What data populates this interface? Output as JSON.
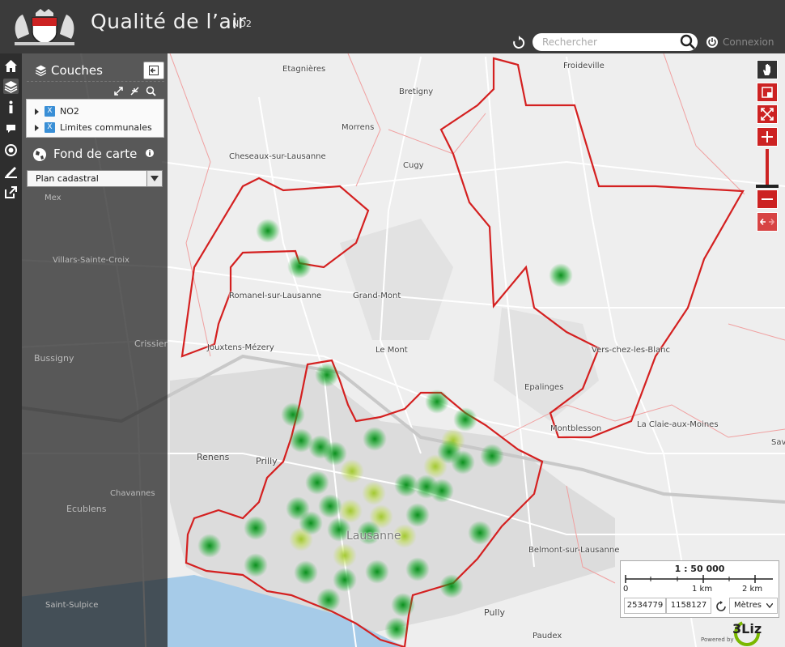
{
  "header": {
    "title": "Qualité de l’air",
    "subtitle": "NO2",
    "search_placeholder": "Rechercher",
    "login_label": "Connexion"
  },
  "panel": {
    "layers_title": "Couches",
    "layers": [
      {
        "name": "NO2",
        "checked": true
      },
      {
        "name": "Limites communales",
        "checked": true
      }
    ],
    "basemap_title": "Fond de carte",
    "basemap_selected": "Plan cadastral"
  },
  "menu_icons": [
    "home-icon",
    "layers-icon",
    "info-icon",
    "comment-icon",
    "locate-icon",
    "measure-icon",
    "share-icon"
  ],
  "nav_icons": [
    "pan-icon",
    "zoom-box-icon",
    "zoom-extent-icon",
    "zoom-in-icon",
    "zoom-out-icon",
    "previous-view-icon"
  ],
  "places": [
    "Froideville",
    "Etagnières",
    "Bretigny",
    "Morrens",
    "Cheseaux-sur-Lausanne",
    "Cugy",
    "Romanel-sur-Lausanne",
    "Grand-Mont",
    "Jouxtens-Mézery",
    "Le Mont",
    "Vers-chez-les-Blanc",
    "Epalinges",
    "Montblesson",
    "La Claie-aux-Moines",
    "Renens",
    "Prilly",
    "Lausanne",
    "Belmont-sur-Lausanne",
    "Pully",
    "Paudex",
    "Sav",
    "Mex",
    "Villars-Sainte-Croix",
    "Bussigny",
    "Crissier",
    "Chavannes",
    "Ecublens",
    "Saint-Sulpice"
  ],
  "scale": {
    "ratio": "1 : 50 000",
    "ticks": [
      "0",
      "1 km",
      "2 km"
    ],
    "x": "2534779",
    "y": "1158127",
    "unit": "Mètres"
  },
  "footer": {
    "powered_by": "Powered by",
    "brand": "3Liz"
  },
  "colors": {
    "header_bg": "#3b3b3b",
    "accent_red": "#cc2222",
    "boundary_red": "#d42020",
    "checkbox_blue": "#3a8fd6",
    "lake_blue": "#a6cbe8"
  }
}
